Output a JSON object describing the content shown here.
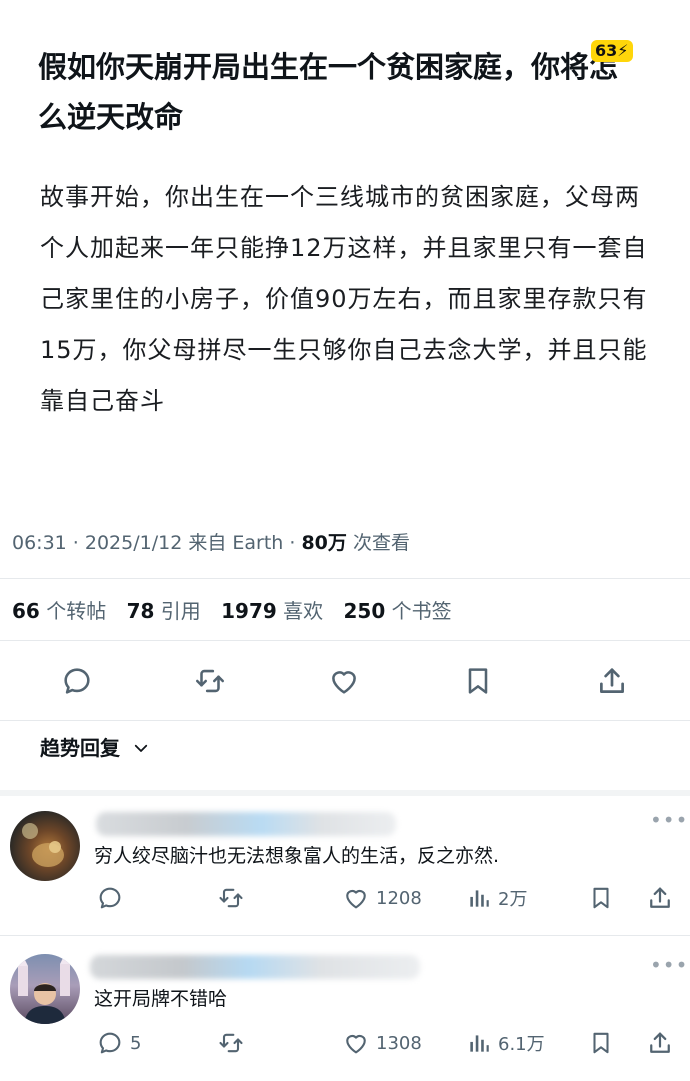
{
  "post": {
    "title": "假如你天崩开局出生在一个贫困家庭，你将怎么逆天改命",
    "badge": "63⚡",
    "body": "故事开始，你出生在一个三线城市的贫困家庭，父母两个人加起来一年只能挣12万这样，并且家里只有一套自己家里住的小房子，价值90万左右，而且家里存款只有15万，你父母拼尽一生只够你自己去念大学，并且只能靠自己奋斗",
    "meta_time": "06:31 · 2025/1/12 来自 Earth · ",
    "meta_views": "80万",
    "meta_views_label": " 次查看"
  },
  "stats": {
    "retweets": "66",
    "retweets_label": "个转帖",
    "quotes": "78",
    "quotes_label": "引用",
    "likes": "1979",
    "likes_label": "喜欢",
    "bookmarks": "250",
    "bookmarks_label": "个书签"
  },
  "actions": [
    "reply-icon",
    "retweet-icon",
    "like-icon",
    "bookmark-icon",
    "share-icon"
  ],
  "trend": {
    "label": "趋势回复"
  },
  "replies": [
    {
      "text": "穷人绞尽脑汁也无法想象富人的生活，反之亦然.",
      "reply_count": "",
      "likes": "1208",
      "views": "2万"
    },
    {
      "text": "这开局牌不错哈",
      "reply_count": "5",
      "likes": "1308",
      "views": "6.1万"
    }
  ],
  "colors": {
    "text": "#0f1419",
    "secondary": "#536471",
    "badge": "#ffd60a",
    "divider": "#e6e9ec"
  }
}
